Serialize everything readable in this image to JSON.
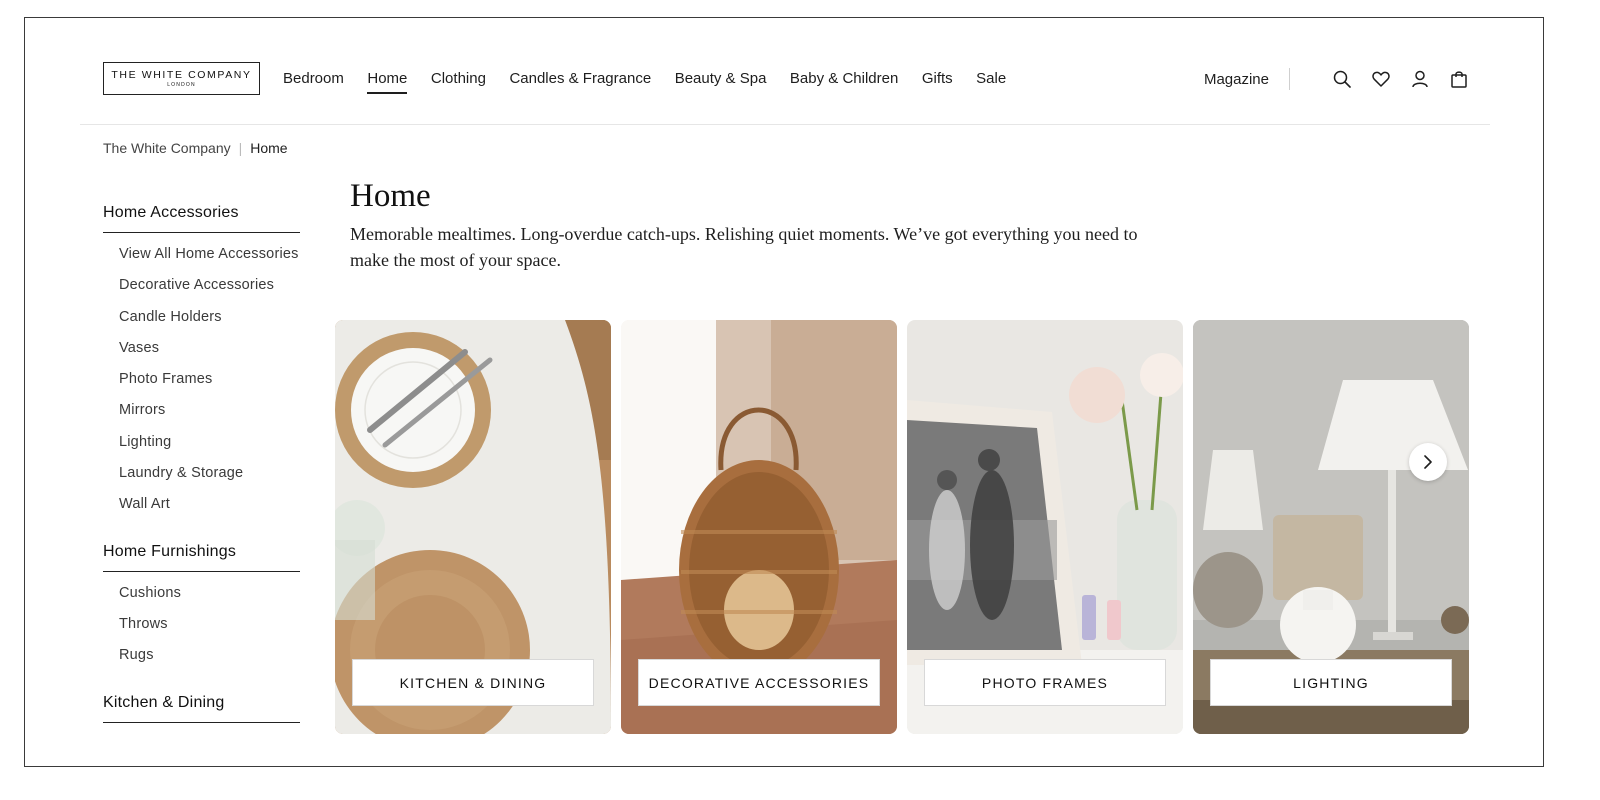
{
  "header": {
    "logo": {
      "main": "THE WHITE COMPANY",
      "sub": "LONDON"
    },
    "nav": [
      {
        "label": "Bedroom",
        "active": false
      },
      {
        "label": "Home",
        "active": true
      },
      {
        "label": "Clothing",
        "active": false
      },
      {
        "label": "Candles & Fragrance",
        "active": false
      },
      {
        "label": "Beauty & Spa",
        "active": false
      },
      {
        "label": "Baby & Children",
        "active": false
      },
      {
        "label": "Gifts",
        "active": false
      },
      {
        "label": "Sale",
        "active": false
      }
    ],
    "magazine_label": "Magazine",
    "icons": [
      "search-icon",
      "wishlist-heart-icon",
      "account-icon",
      "shopping-bag-icon"
    ]
  },
  "breadcrumb": {
    "root": "The White Company",
    "separator": "|",
    "current": "Home"
  },
  "sidebar": {
    "sections": [
      {
        "heading": "Home Accessories",
        "items": [
          "View All Home Accessories",
          "Decorative Accessories",
          "Candle Holders",
          "Vases",
          "Photo Frames",
          "Mirrors",
          "Lighting",
          "Laundry & Storage",
          "Wall Art"
        ]
      },
      {
        "heading": "Home Furnishings",
        "items": [
          "Cushions",
          "Throws",
          "Rugs"
        ]
      },
      {
        "heading": "Kitchen & Dining",
        "items": []
      }
    ]
  },
  "main": {
    "title": "Home",
    "description": "Memorable mealtimes. Long-overdue catch-ups. Relishing quiet moments. We’ve got everything you need to make the most of your space."
  },
  "cards": [
    {
      "label": "KITCHEN & DINING"
    },
    {
      "label": "DECORATIVE ACCESSORIES"
    },
    {
      "label": "PHOTO FRAMES"
    },
    {
      "label": "LIGHTING"
    }
  ],
  "carousel": {
    "next_icon": "chevron-right-icon"
  },
  "colors": {
    "text": "#1e1e1e",
    "border": "#222222",
    "divider": "#e6e6e6"
  }
}
